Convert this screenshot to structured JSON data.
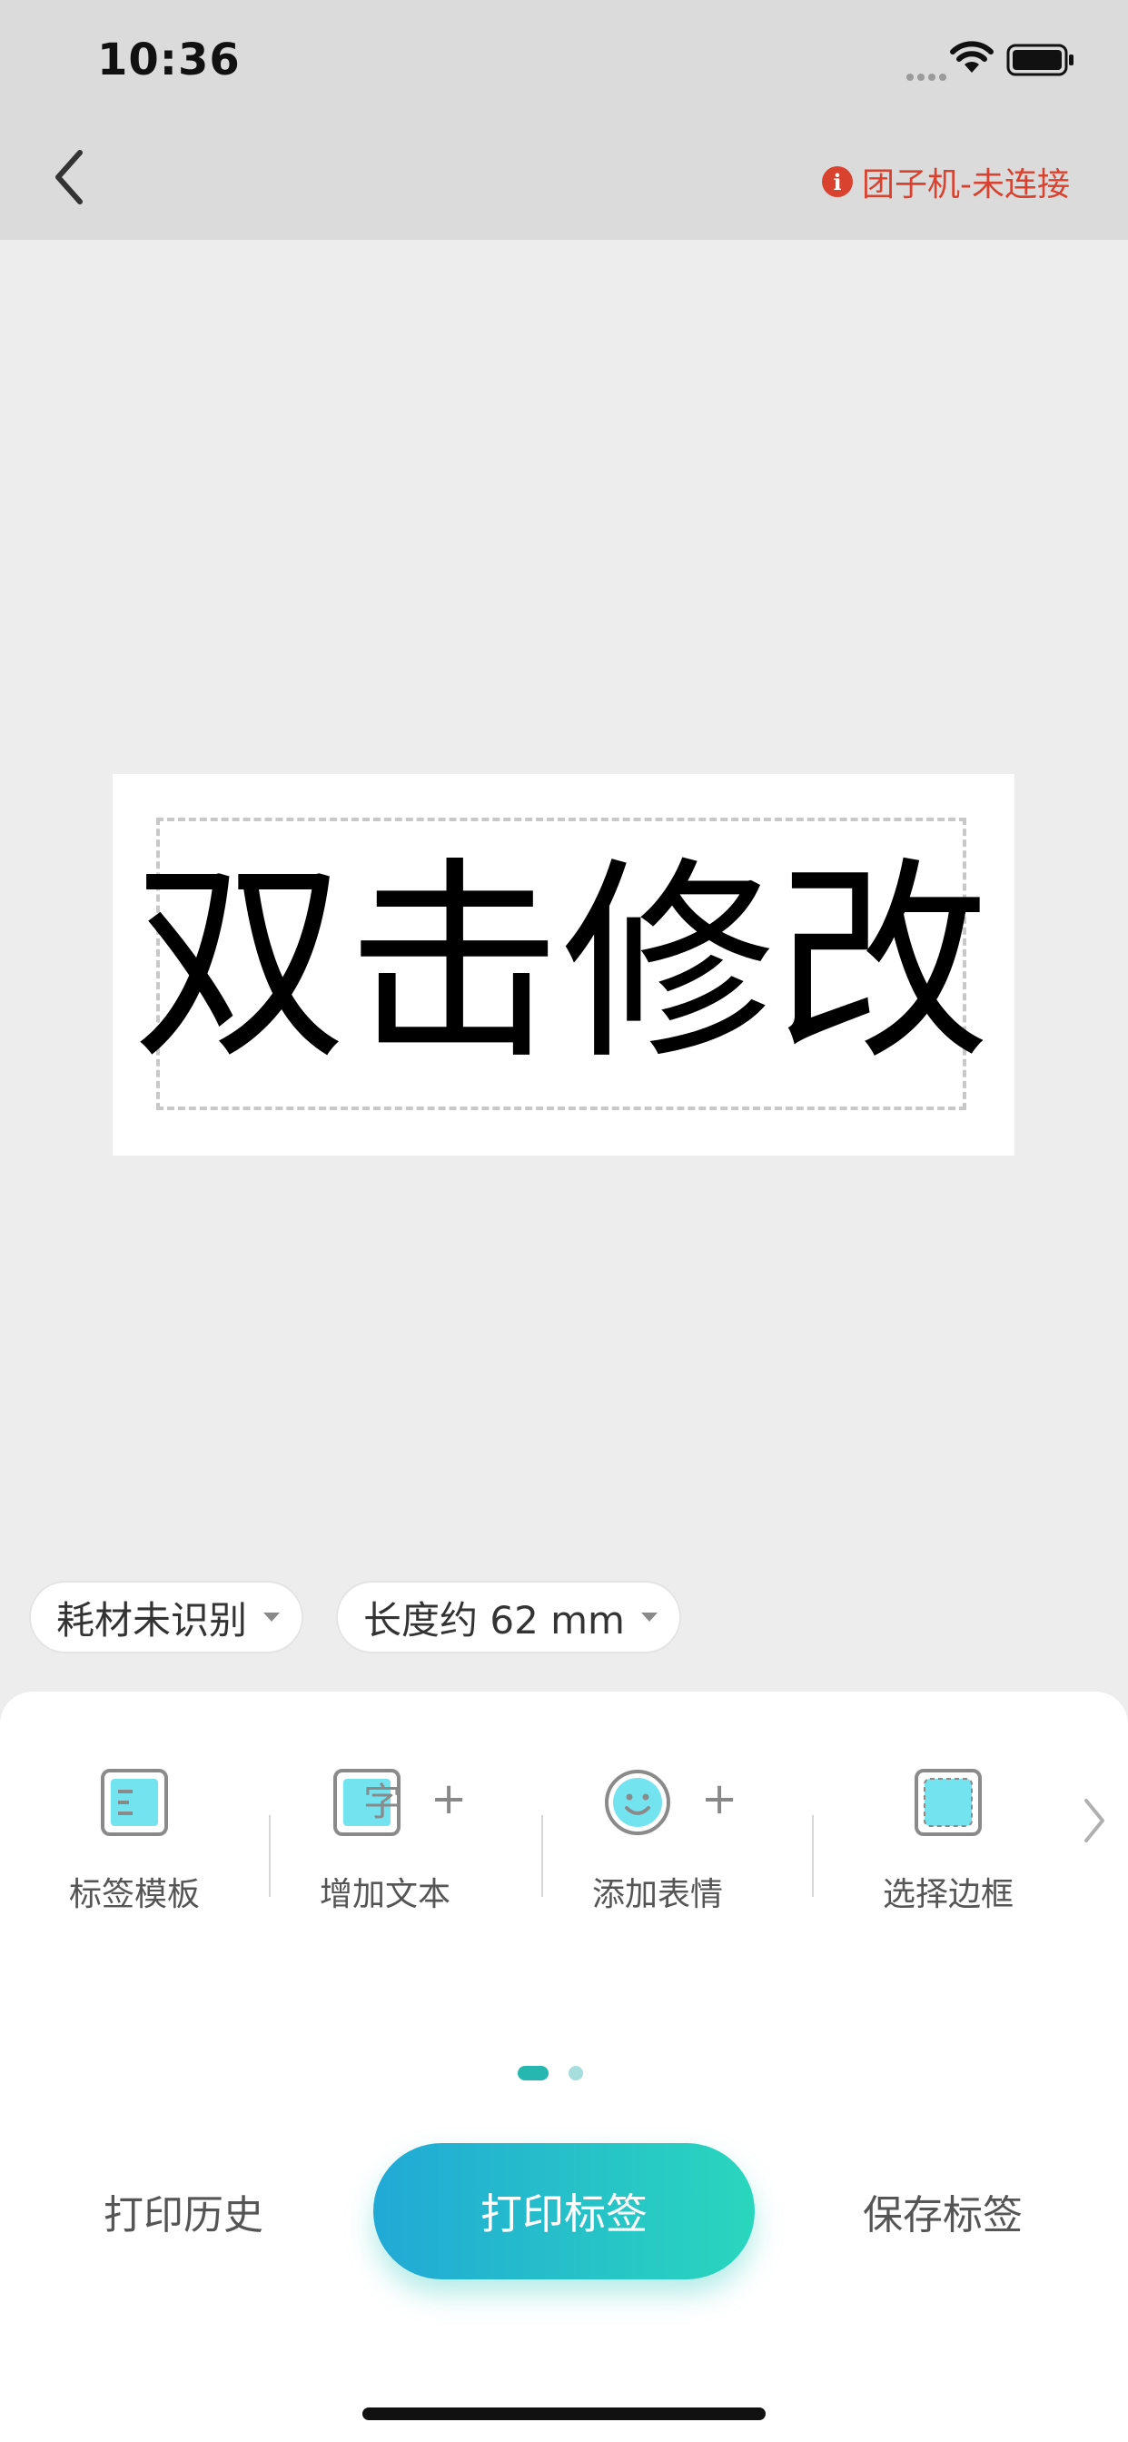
{
  "status_bar": {
    "time": "10:36"
  },
  "header": {
    "connection_status": "团子机-未连接",
    "info_glyph": "i"
  },
  "label_preview": {
    "text": "双击修改"
  },
  "chips": {
    "consumable": "耗材未识别",
    "length": "长度约 62 mm"
  },
  "tools": [
    {
      "label": "标签模板",
      "icon": "template-icon"
    },
    {
      "label": "增加文本",
      "icon": "add-text-icon",
      "glyph": "字"
    },
    {
      "label": "添加表情",
      "icon": "emoji-icon"
    },
    {
      "label": "选择边框",
      "icon": "border-icon"
    }
  ],
  "plus_glyph": "+",
  "pager": {
    "pages": 2,
    "current": 1
  },
  "actions": {
    "history": "打印历史",
    "print": "打印标签",
    "save": "保存标签"
  },
  "colors": {
    "accent_start": "#21a9d6",
    "accent_end": "#2ad6bd",
    "error": "#d8422f",
    "icon_fill": "#74e3f0"
  }
}
